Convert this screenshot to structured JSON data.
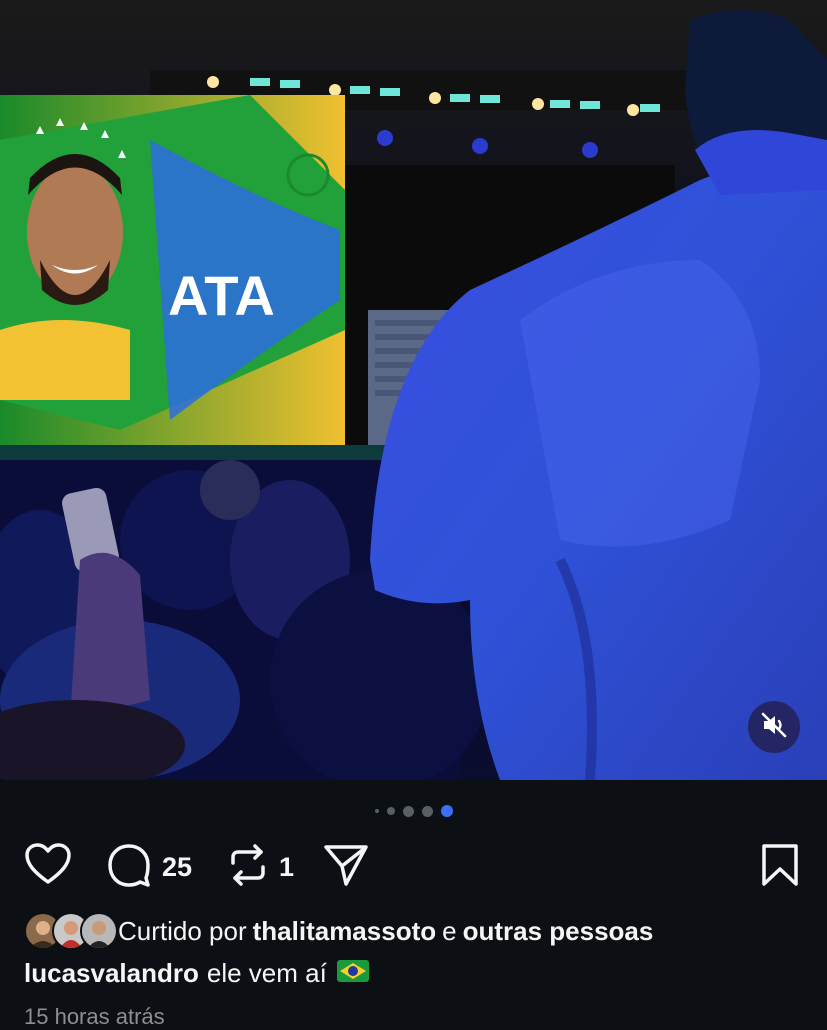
{
  "media": {
    "stage_screen_text": "ATA",
    "mute_icon": "speaker-muted-icon",
    "carousel": {
      "total": 5,
      "active_index": 4
    }
  },
  "actions": {
    "like_icon": "heart-icon",
    "comment_icon": "comment-icon",
    "comment_count": "25",
    "repost_icon": "repost-icon",
    "repost_count": "1",
    "share_icon": "send-icon",
    "save_icon": "bookmark-icon"
  },
  "likes": {
    "prefix": "Curtido por",
    "user": "thalitamassoto",
    "conj": "e",
    "others": "outras pessoas"
  },
  "caption": {
    "username": "lucasvalandro",
    "text": "ele vem aí"
  },
  "timestamp": "15 horas atrás",
  "colors": {
    "background": "#0c1014",
    "accent": "#3d6ef6",
    "text": "#f5f5f5",
    "muted": "#8e8e8e"
  }
}
